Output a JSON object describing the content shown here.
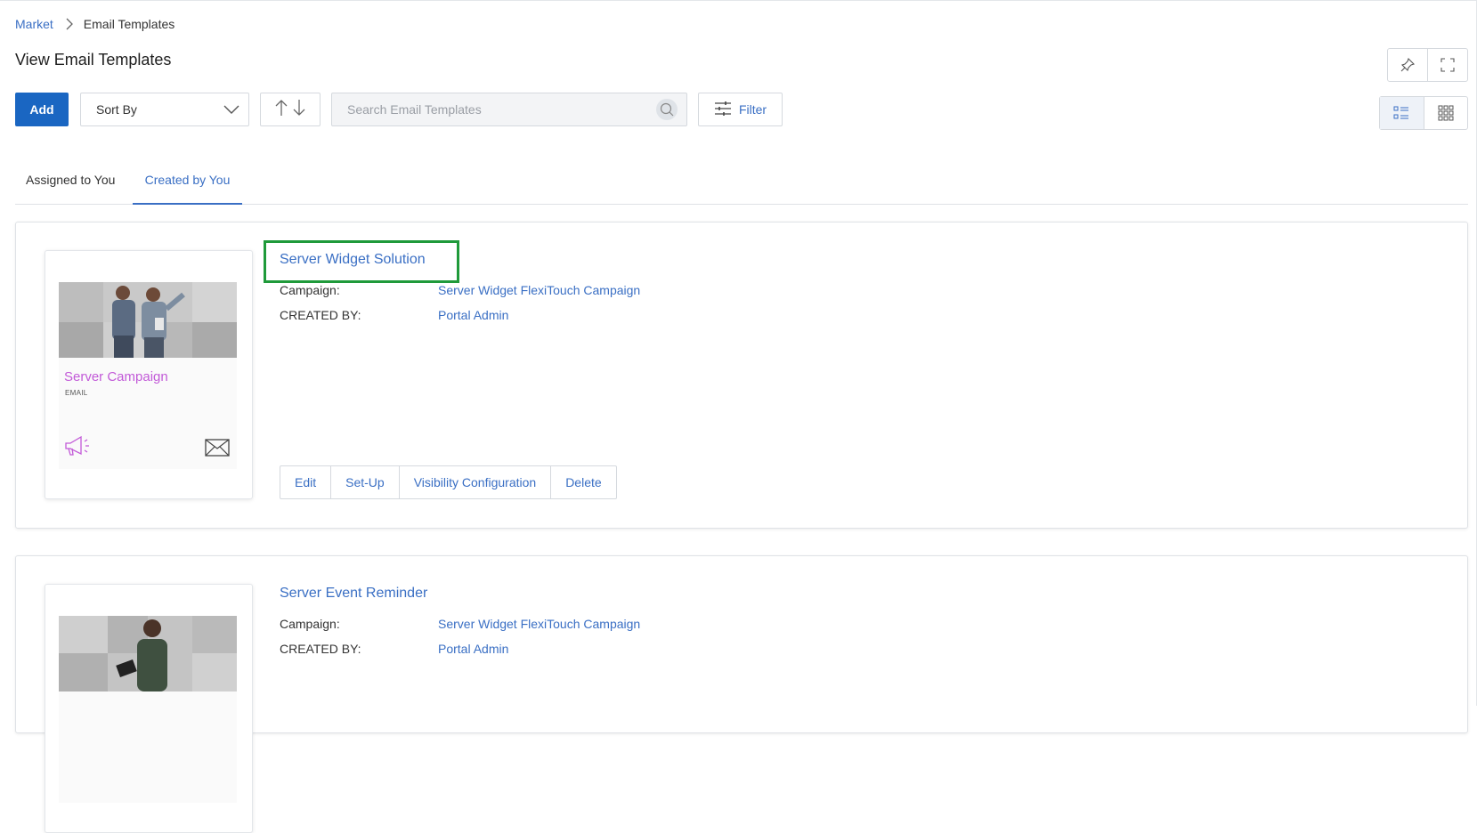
{
  "breadcrumb": {
    "parent": "Market",
    "current": "Email Templates"
  },
  "page": {
    "title": "View Email Templates"
  },
  "toolbar": {
    "add_label": "Add",
    "sort_label": "Sort By",
    "search_placeholder": "Search Email Templates",
    "filter_label": "Filter"
  },
  "tabs": [
    {
      "label": "Assigned to You",
      "active": false
    },
    {
      "label": "Created by You",
      "active": true
    }
  ],
  "cards": [
    {
      "title": "Server Widget Solution",
      "thumbnail": {
        "title": "Server Campaign",
        "type": "EMAIL"
      },
      "campaign_label": "Campaign:",
      "campaign_value": "Server Widget FlexiTouch Campaign",
      "created_by_label": "CREATED BY:",
      "created_by_value": "Portal Admin",
      "actions": [
        "Edit",
        "Set-Up",
        "Visibility Configuration",
        "Delete"
      ]
    },
    {
      "title": "Server Event Reminder",
      "campaign_label": "Campaign:",
      "campaign_value": "Server Widget FlexiTouch Campaign",
      "created_by_label": "CREATED BY:",
      "created_by_value": "Portal Admin"
    }
  ],
  "colors": {
    "primary": "#1a66c2",
    "link": "#3a6fc4",
    "thumbnail_accent": "#c25ad8",
    "highlight_box": "#1f9a3a"
  },
  "icons": [
    "chevron-right-icon",
    "pin-icon",
    "fullscreen-icon",
    "chevron-down-icon",
    "sort-up-icon",
    "sort-down-icon",
    "search-icon",
    "filter-sliders-icon",
    "list-view-icon",
    "grid-view-icon",
    "megaphone-icon",
    "envelope-icon"
  ]
}
